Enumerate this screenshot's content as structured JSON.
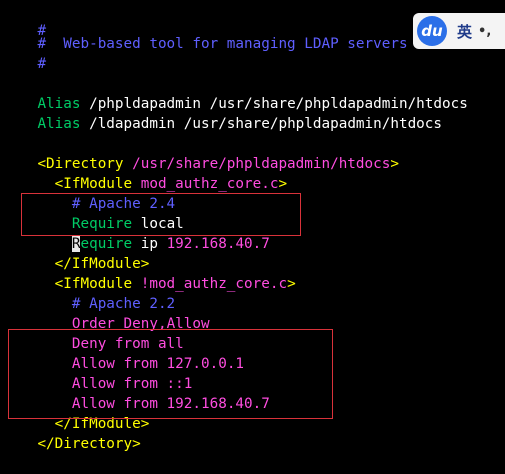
{
  "editor": {
    "lines": {
      "l1": {
        "text": "#"
      },
      "l2": {
        "text": "#  Web-based tool for managing LDAP servers"
      },
      "l3": {
        "text": "#"
      },
      "l5": {
        "kw": "Alias",
        "rest": " /phpldapadmin /usr/share/phpldapadmin/htdocs"
      },
      "l6": {
        "kw": "Alias",
        "rest": " /ldapadmin /usr/share/phpldapadmin/htdocs"
      },
      "l8": {
        "tag": "<Directory",
        "path": " /usr/share/phpldapadmin/htdocs",
        "close": ">"
      },
      "l9": {
        "indent": "  ",
        "tag": "<IfModule",
        "arg": " mod_authz_core.c",
        "close": ">"
      },
      "l10": {
        "indent": "    ",
        "text": "# Apache 2.4"
      },
      "l11": {
        "indent": "    ",
        "kw": "Require",
        "arg": " local"
      },
      "l12": {
        "indent": "    ",
        "cursor": "R",
        "kw": "equire",
        "mid": " ip ",
        "arg": "192.168.40.7"
      },
      "l13": {
        "indent": "  ",
        "text": "</IfModule>"
      },
      "l14": {
        "indent": "  ",
        "tag": "<IfModule",
        "arg": " !mod_authz_core.c",
        "close": ">"
      },
      "l15": {
        "indent": "    ",
        "text": "# Apache 2.2"
      },
      "l16": {
        "indent": "    ",
        "kw": "Order",
        "arg": " Deny,Allow"
      },
      "l17": {
        "indent": "    ",
        "kw": "Deny from",
        "arg": " all"
      },
      "l18": {
        "indent": "    ",
        "kw": "Allow from",
        "arg": " 127.0.0.1"
      },
      "l19": {
        "indent": "    ",
        "kw": "Allow from",
        "arg": " ::1"
      },
      "l20": {
        "indent": "    ",
        "kw": "Allow from",
        "arg": " 192.168.40.7"
      },
      "l21": {
        "indent": "  ",
        "text": "</IfModule>"
      },
      "l22": {
        "text": "</Directory>"
      }
    }
  },
  "ime": {
    "logo_text": "du",
    "lang": "英",
    "punct": "•,"
  },
  "colors": {
    "background": "#000000",
    "comment": "#5f5fff",
    "keyword": "#00cc66",
    "path": "#ff4de0",
    "tag": "#ffff00",
    "highlight_box": "#d9323a"
  }
}
